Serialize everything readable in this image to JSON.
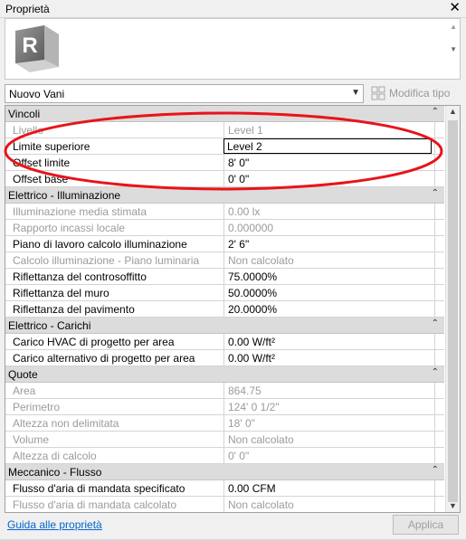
{
  "window": {
    "title": "Proprietà"
  },
  "type_selector": {
    "value": "Nuovo Vani",
    "edit_type_label": "Modifica tipo"
  },
  "preview": {
    "logo_letter": "R"
  },
  "sections": [
    {
      "name": "Vincoli",
      "rows": [
        {
          "name": "Livello",
          "value": "Level 1",
          "readonly": true
        },
        {
          "name": "Limite superiore",
          "value": "Level 2",
          "readonly": false,
          "editing": true
        },
        {
          "name": "Offset limite",
          "value": "8'  0\"",
          "readonly": false
        },
        {
          "name": "Offset base",
          "value": "0'  0\"",
          "readonly": false
        }
      ]
    },
    {
      "name": "Elettrico - Illuminazione",
      "rows": [
        {
          "name": "Illuminazione media stimata",
          "value": "0.00 lx",
          "readonly": true
        },
        {
          "name": "Rapporto incassi locale",
          "value": "0.000000",
          "readonly": true
        },
        {
          "name": "Piano di lavoro calcolo illuminazione",
          "value": "2'  6\"",
          "readonly": false
        },
        {
          "name": "Calcolo illuminazione - Piano luminaria",
          "value": "Non calcolato",
          "readonly": true
        },
        {
          "name": "Riflettanza del controsoffitto",
          "value": "75.0000%",
          "readonly": false
        },
        {
          "name": "Riflettanza del muro",
          "value": "50.0000%",
          "readonly": false
        },
        {
          "name": "Riflettanza del pavimento",
          "value": "20.0000%",
          "readonly": false
        }
      ]
    },
    {
      "name": "Elettrico - Carichi",
      "rows": [
        {
          "name": "Carico HVAC di progetto per area",
          "value": "0.00 W/ft²",
          "readonly": false
        },
        {
          "name": "Carico alternativo di progetto per area",
          "value": "0.00 W/ft²",
          "readonly": false
        }
      ]
    },
    {
      "name": "Quote",
      "rows": [
        {
          "name": "Area",
          "value": "864.75",
          "readonly": true
        },
        {
          "name": "Perimetro",
          "value": "124'  0 1/2\"",
          "readonly": true
        },
        {
          "name": "Altezza non delimitata",
          "value": "18'  0\"",
          "readonly": true
        },
        {
          "name": "Volume",
          "value": "Non calcolato",
          "readonly": true
        },
        {
          "name": "Altezza di calcolo",
          "value": "0'  0\"",
          "readonly": true
        }
      ]
    },
    {
      "name": "Meccanico - Flusso",
      "rows": [
        {
          "name": "Flusso d'aria di mandata specificato",
          "value": "0.00 CFM",
          "readonly": false
        },
        {
          "name": "Flusso d'aria di mandata calcolato",
          "value": "Non calcolato",
          "readonly": true
        }
      ]
    }
  ],
  "footer": {
    "help_link": "Guida alle proprietà",
    "apply_label": "Applica"
  },
  "colors": {
    "annotation": "#e8141a",
    "link": "#0066cc",
    "section_bg": "#dcdcdc",
    "readonly_text": "#9b9b9b"
  }
}
